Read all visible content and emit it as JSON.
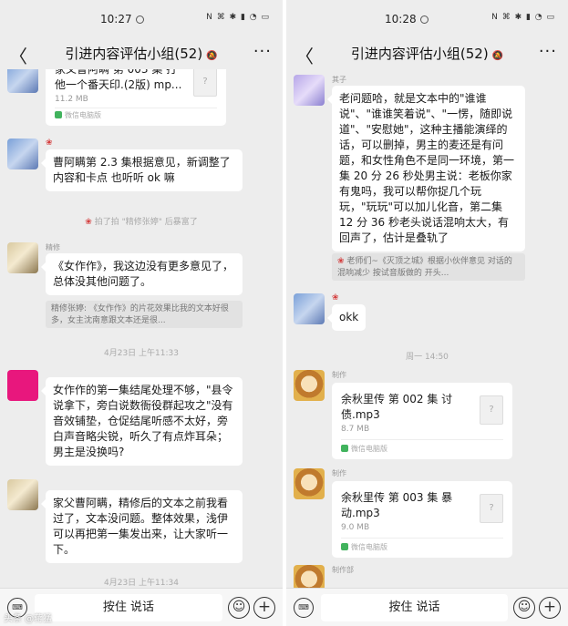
{
  "left": {
    "status": {
      "time": "10:27",
      "icons": "N ⌘ ✱ ▮ ◔ ▭"
    },
    "header": {
      "back": "〈",
      "title": "引进内容评估小组(52)",
      "mute": "🔕",
      "more": "···"
    },
    "file1": {
      "name": "家父曹阿瞒 第 003 集 打他一个番天印.(2版) mp...",
      "size": "11.2 MB",
      "source": "微信电脑版"
    },
    "msg1": {
      "text": "曹阿瞒第 2.3 集根据意见，新调整了内容和卡点 也听听 ok 嘛"
    },
    "sys1": "拍了拍 \"精修张婷\" 后暴富了",
    "msg2": {
      "nick": "精修",
      "text": "《女作作》，我这边没有更多意见了，总体没其他问题了。",
      "quote": "精修张婷: 《女作作》的片花效果比我的文本好很多，女主沈南意跟文本还是很..."
    },
    "time1": "4月23日 上午11:33",
    "msg3": {
      "text": "女作作的第一集结尾处理不够，\"县令说拿下，旁白说数衙役群起攻之\"没有音效铺垫，仓促结尾听感不太好，旁白声音略尖锐，听久了有点炸耳朵；男主是没换吗?"
    },
    "msg4": {
      "text": "家父曹阿瞒，精修后的文本之前我看过了，文本没问题。整体效果，浅伊可以再把第一集发出来，让大家听一下。"
    },
    "time2": "4月23日 上午11:34",
    "input": {
      "kbd": "⌨",
      "talk": "按住 说话",
      "emoji": "☺",
      "plus": "+"
    },
    "watermark": "头条 @蒋猛"
  },
  "right": {
    "status": {
      "time": "10:28",
      "icons": "N ⌘ ✱ ▮ ◔ ▭"
    },
    "header": {
      "back": "〈",
      "title": "引进内容评估小组(52)",
      "mute": "🔕",
      "more": "···"
    },
    "msg1": {
      "nick": "其子",
      "text": "老问题哈，就是文本中的\"谁谁说\"、\"谁谁笑着说\"、\"一愣，随即说道\"、\"安慰她\"，这种主播能演绎的话，可以删掉，男主的麦还是有问题，和女性角色不是同一环境，第一集 20 分 26 秒处男主说：老板你家有鬼吗，我可以帮你捉几个玩玩，\"玩玩\"可以加儿化音，第二集 12 分 36 秒老头说话混响太大，有回声了，估计是叠轨了",
      "quote": "老师们~《灭顶之城》根据小伙伴意见 对话的混响减少 按试音版做的 开头..."
    },
    "msg2": {
      "text": "okk"
    },
    "time1": "周一 14:50",
    "file1": {
      "nick": "制作",
      "name": "余秋里传 第 002 集 讨债.mp3",
      "size": "8.7 MB",
      "source": "微信电脑版"
    },
    "file2": {
      "nick": "制作",
      "name": "余秋里传 第 003 集 暴动.mp3",
      "size": "9.0 MB",
      "source": "微信电脑版"
    },
    "nick3": "制作部",
    "input": {
      "kbd": "⌨",
      "talk": "按住 说话",
      "emoji": "☺",
      "plus": "+"
    }
  }
}
